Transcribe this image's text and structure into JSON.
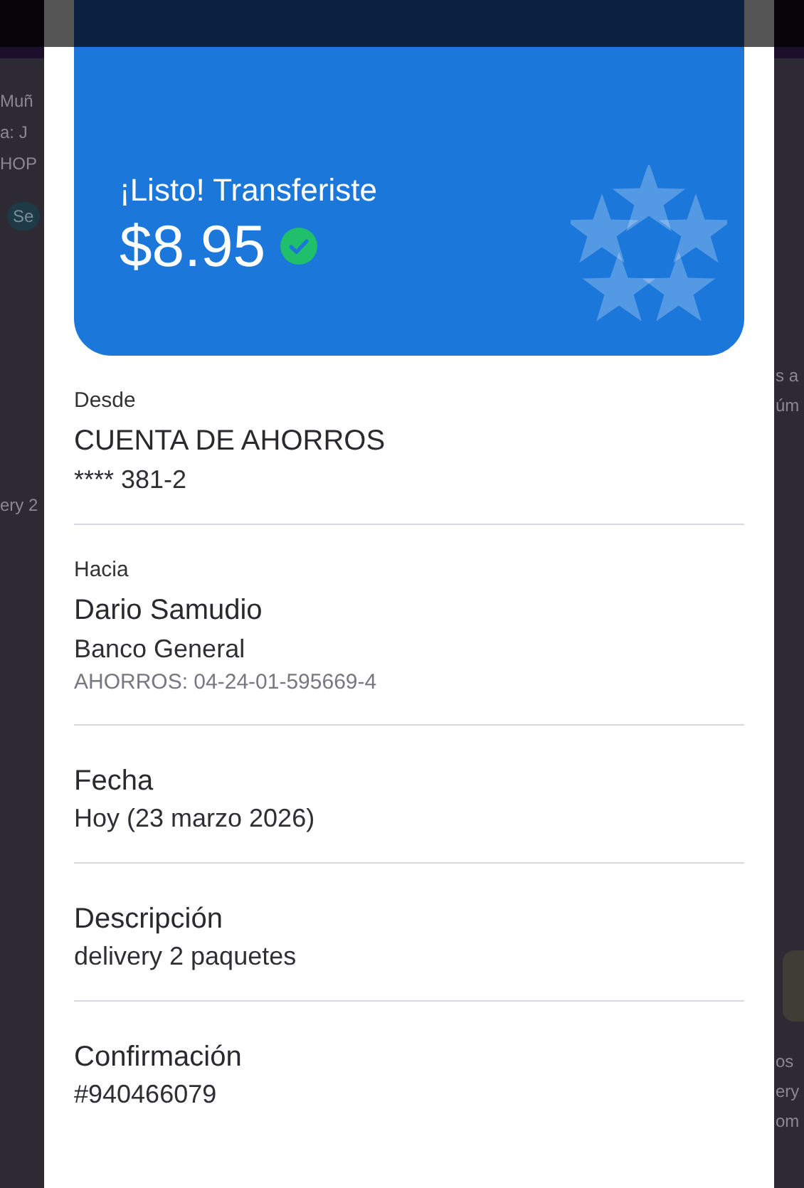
{
  "background": {
    "left": [
      {
        "kind": "text",
        "text": "Muñ"
      },
      {
        "kind": "text",
        "text": "a: J"
      },
      {
        "kind": "text",
        "text": "HOP"
      },
      {
        "kind": "chip",
        "text": "Se"
      },
      {
        "kind": "text",
        "text": "ery 2"
      }
    ],
    "right": [
      {
        "kind": "text",
        "text": "s a"
      },
      {
        "kind": "text",
        "text": "úm"
      },
      {
        "kind": "text",
        "text": "os"
      },
      {
        "kind": "text",
        "text": "ery"
      },
      {
        "kind": "text",
        "text": "om"
      }
    ]
  },
  "receipt": {
    "banner": {
      "title": "¡Listo! Transferiste",
      "amount": "$8.95",
      "confirmed": true
    },
    "sections": [
      {
        "kind": "account",
        "label": "Desde",
        "title": "CUENTA DE AHORROS",
        "lines": [
          "**** 381-2"
        ]
      },
      {
        "kind": "account",
        "label": "Hacia",
        "title": "Dario Samudio",
        "lines": [
          "Banco General"
        ],
        "note": "AHORROS: 04-24-01-595669-4"
      },
      {
        "kind": "field",
        "label": "Fecha",
        "value": "Hoy (23 marzo 2026)"
      },
      {
        "kind": "field",
        "label": "Descripción",
        "value": "delivery 2 paquetes"
      },
      {
        "kind": "field",
        "label": "Confirmación",
        "value": "#940466079"
      }
    ]
  }
}
